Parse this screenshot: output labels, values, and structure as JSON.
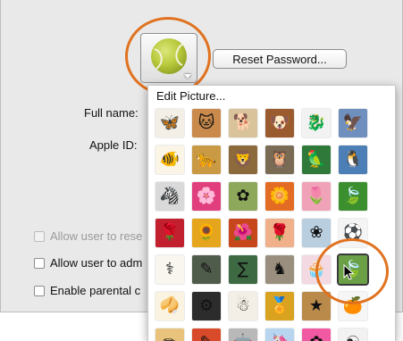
{
  "reset_password_label": "Reset Password...",
  "full_name_label": "Full name:",
  "apple_id_label": "Apple ID:",
  "checkboxes": [
    {
      "label": "Allow user to rese",
      "checked": false,
      "enabled": false
    },
    {
      "label": "Allow user to adm",
      "checked": false,
      "enabled": true
    },
    {
      "label": "Enable parental c",
      "checked": false,
      "enabled": true
    }
  ],
  "picker": {
    "edit_label": "Edit Picture...",
    "tiles": [
      {
        "icon": "butterfly-icon",
        "glyph": "🦋",
        "bg": "#f3efe6"
      },
      {
        "icon": "cat-icon",
        "glyph": "🐱",
        "bg": "#c98a4b"
      },
      {
        "icon": "dog-icon",
        "glyph": "🐕",
        "bg": "#d8c39a"
      },
      {
        "icon": "dog-icon",
        "glyph": "🐶",
        "bg": "#9a5b2e"
      },
      {
        "icon": "dragonfly-icon",
        "glyph": "🐉",
        "bg": "#f2f2f2"
      },
      {
        "icon": "eagle-icon",
        "glyph": "🦅",
        "bg": "#6f8fbf"
      },
      {
        "icon": "goldfish-icon",
        "glyph": "🐠",
        "bg": "#fbf5e8"
      },
      {
        "icon": "leopard-icon",
        "glyph": "🐆",
        "bg": "#c99a43"
      },
      {
        "icon": "lion-icon",
        "glyph": "🦁",
        "bg": "#8c6a3c"
      },
      {
        "icon": "owl-icon",
        "glyph": "🦉",
        "bg": "#7a6b55"
      },
      {
        "icon": "parrot-icon",
        "glyph": "🦜",
        "bg": "#2f7a3a"
      },
      {
        "icon": "penguin-icon",
        "glyph": "🐧",
        "bg": "#4b7fb5"
      },
      {
        "icon": "zebra-icon",
        "glyph": "🦓",
        "bg": "#d9d9d9"
      },
      {
        "icon": "flower-icon",
        "glyph": "🌸",
        "bg": "#e03e7d"
      },
      {
        "icon": "dandelion-icon",
        "glyph": "✿",
        "bg": "#8da85b"
      },
      {
        "icon": "flower-icon",
        "glyph": "🌼",
        "bg": "#e46b23"
      },
      {
        "icon": "lotus-icon",
        "glyph": "🌷",
        "bg": "#f0a2b8"
      },
      {
        "icon": "leaf-icon",
        "glyph": "🍃",
        "bg": "#3c8f2f"
      },
      {
        "icon": "rose-icon",
        "glyph": "🌹",
        "bg": "#c21f2f"
      },
      {
        "icon": "sunflower-icon",
        "glyph": "🌻",
        "bg": "#e5a51c"
      },
      {
        "icon": "flower-icon",
        "glyph": "🌺",
        "bg": "#c7461c"
      },
      {
        "icon": "rose-icon",
        "glyph": "🌹",
        "bg": "#f0b08a"
      },
      {
        "icon": "dandelion-icon",
        "glyph": "❀",
        "bg": "#b9cfe0"
      },
      {
        "icon": "beach-ball-icon",
        "glyph": "⚽",
        "bg": "#f4f4f4"
      },
      {
        "icon": "caduceus-icon",
        "glyph": "⚕",
        "bg": "#f8f6ee"
      },
      {
        "icon": "chalkboard-icon",
        "glyph": "✎",
        "bg": "#4f5b4b"
      },
      {
        "icon": "chalkboard-icon",
        "glyph": "∑",
        "bg": "#3e6a43"
      },
      {
        "icon": "chess-icon",
        "glyph": "♞",
        "bg": "#9a8f7e"
      },
      {
        "icon": "cupcake-icon",
        "glyph": "🧁",
        "bg": "#f2d9e2"
      },
      {
        "icon": "leaves-icon",
        "glyph": "🍃",
        "bg": "#6ba046"
      },
      {
        "icon": "fortune-cookie-icon",
        "glyph": "🥠",
        "bg": "#fbf3e2"
      },
      {
        "icon": "gear-shift-icon",
        "glyph": "⚙",
        "bg": "#2c2c2c"
      },
      {
        "icon": "gingerbread-icon",
        "glyph": "☃",
        "bg": "#f4efe6"
      },
      {
        "icon": "medal-icon",
        "glyph": "🏅",
        "bg": "#d9a21f"
      },
      {
        "icon": "star-icon",
        "glyph": "★",
        "bg": "#b98a4a"
      },
      {
        "icon": "orange-icon",
        "glyph": "🍊",
        "bg": "#f6f6f6"
      },
      {
        "icon": "pencil-icon",
        "glyph": "✏",
        "bg": "#e9c37b"
      },
      {
        "icon": "pencils-icon",
        "glyph": "✎",
        "bg": "#d84a2a"
      },
      {
        "icon": "robot-icon",
        "glyph": "🤖",
        "bg": "#b8b8b8"
      },
      {
        "icon": "unicorn-icon",
        "glyph": "🦄",
        "bg": "#b7d5ef"
      },
      {
        "icon": "flower-icon",
        "glyph": "✿",
        "bg": "#f15aa3"
      },
      {
        "icon": "yin-yang-icon",
        "glyph": "☯",
        "bg": "#f2f2f2"
      }
    ],
    "selected_tile": 29
  },
  "colors": {
    "highlight": "#e0721f"
  }
}
